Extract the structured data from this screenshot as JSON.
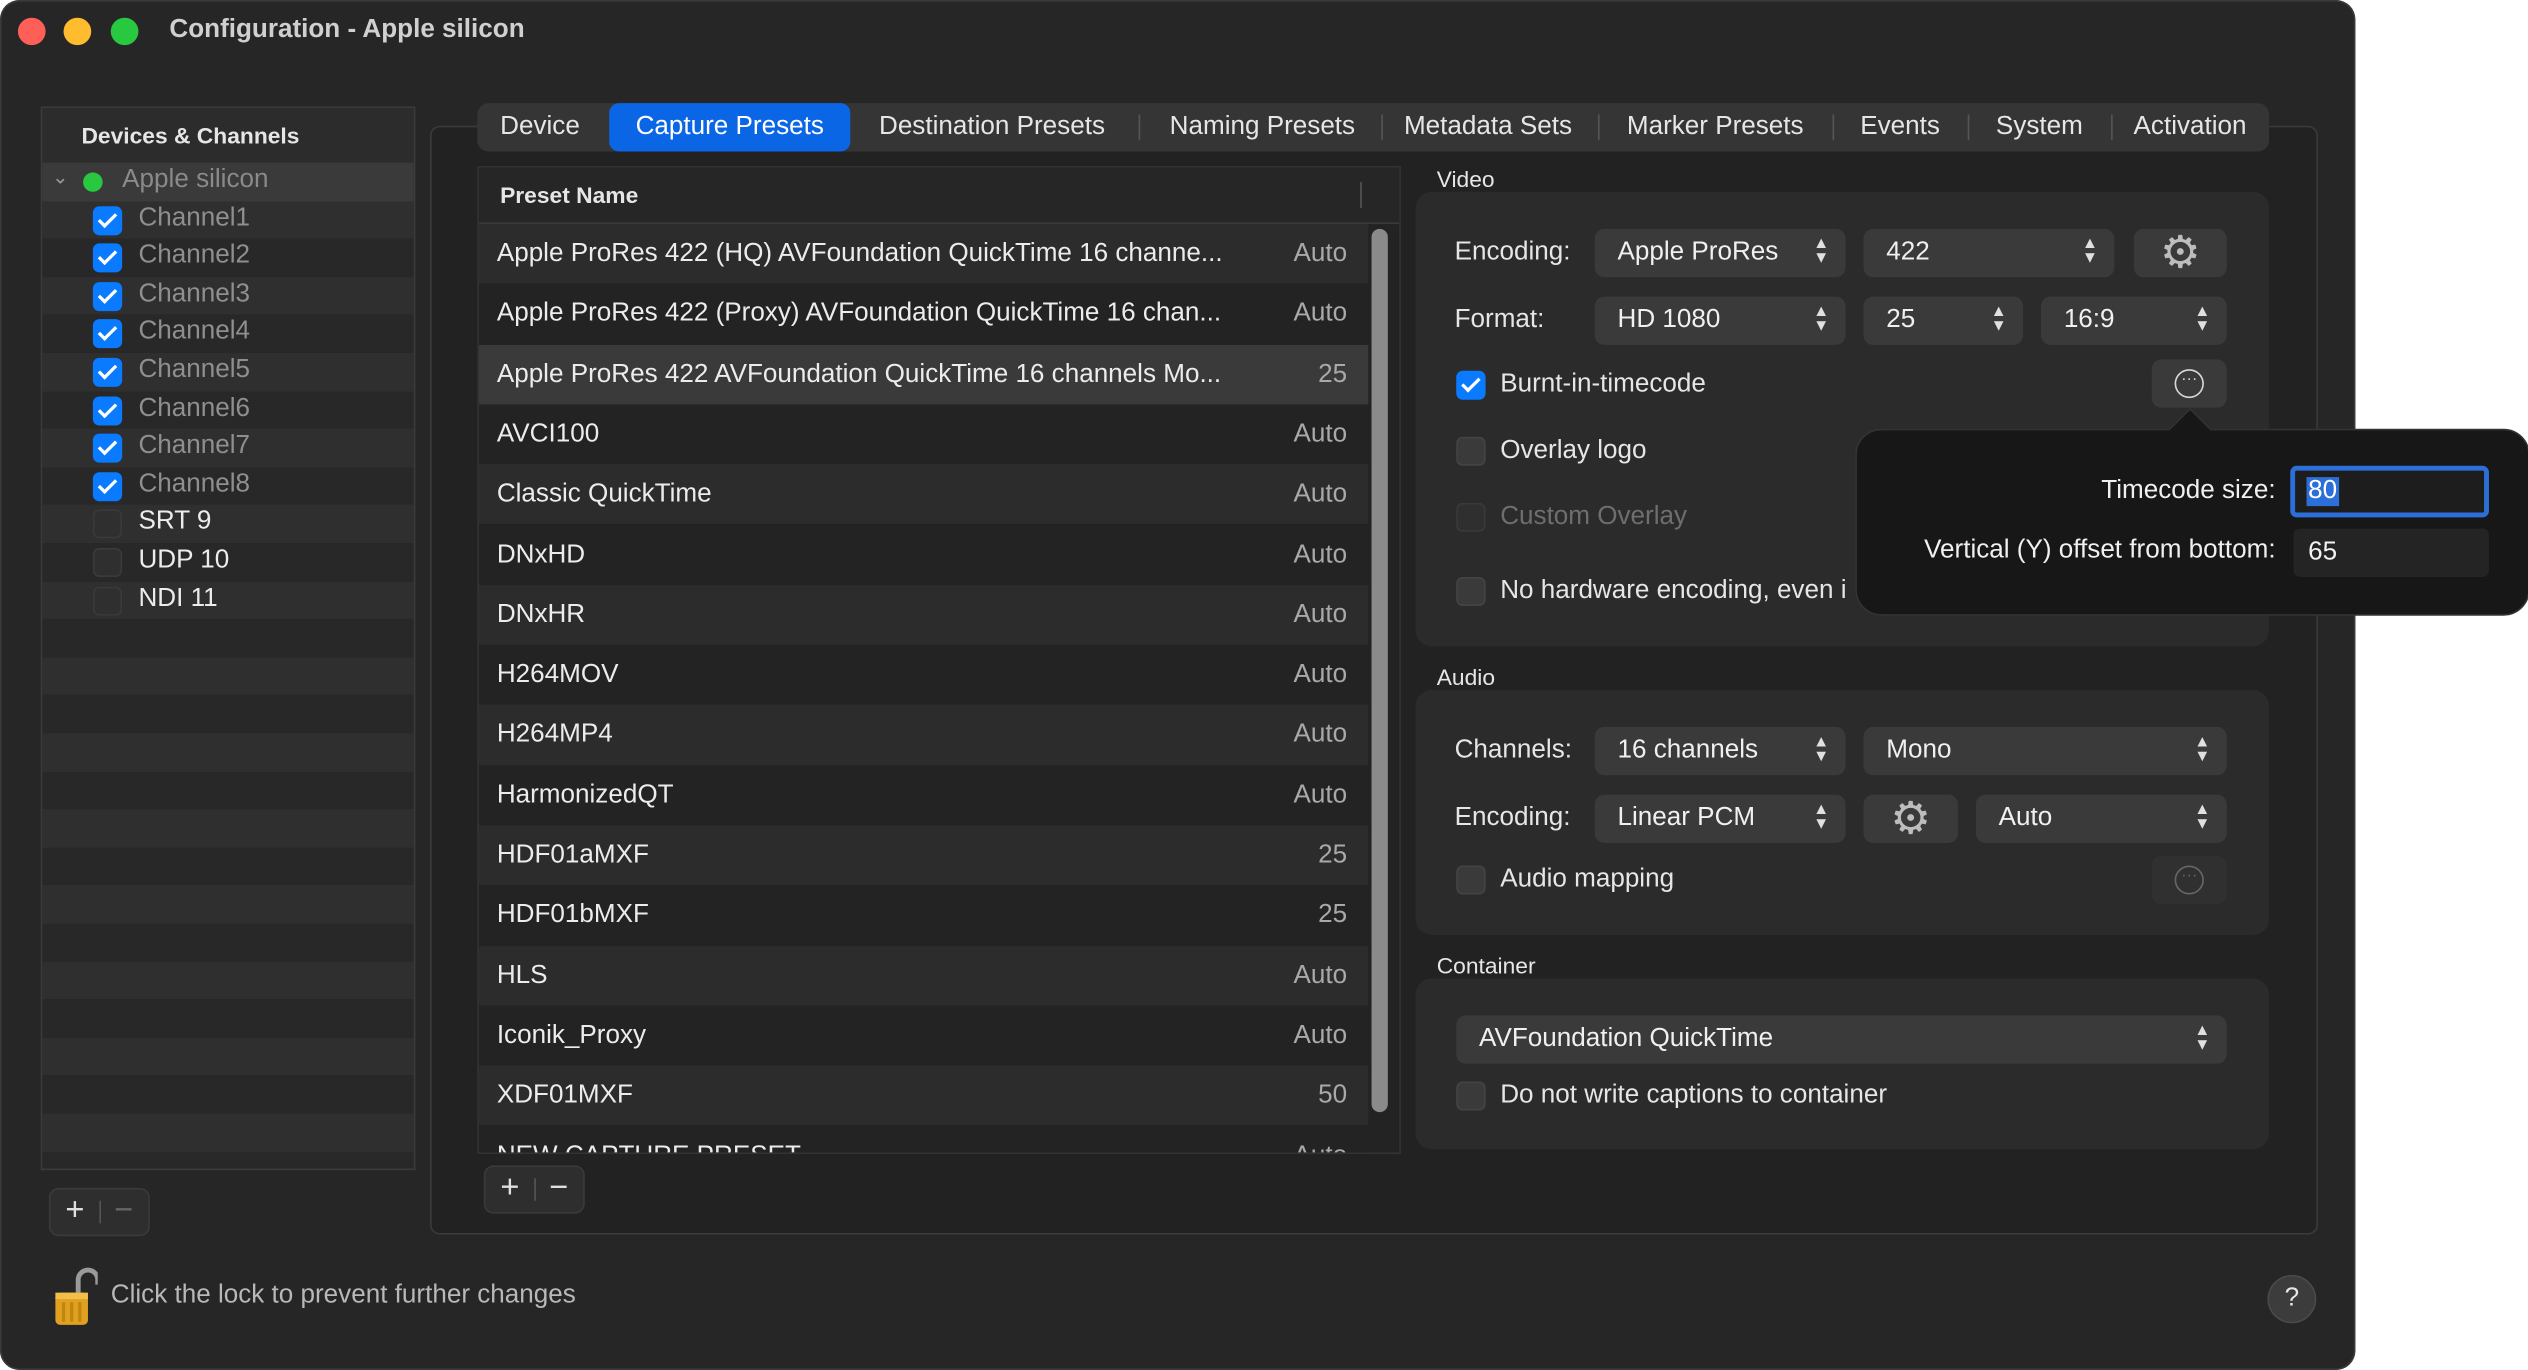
{
  "window": {
    "title": "Configuration - Apple silicon",
    "traffic_colors": [
      "#ff5f57",
      "#febc2e",
      "#28c840"
    ]
  },
  "sidebar": {
    "header": "Devices & Channels",
    "root": {
      "label": "Apple silicon",
      "status_color": "#28c840"
    },
    "items": [
      {
        "label": "Channel1",
        "checked": true
      },
      {
        "label": "Channel2",
        "checked": true
      },
      {
        "label": "Channel3",
        "checked": true
      },
      {
        "label": "Channel4",
        "checked": true
      },
      {
        "label": "Channel5",
        "checked": true
      },
      {
        "label": "Channel6",
        "checked": true
      },
      {
        "label": "Channel7",
        "checked": true
      },
      {
        "label": "Channel8",
        "checked": true
      },
      {
        "label": "SRT 9",
        "checked": false
      },
      {
        "label": "UDP 10",
        "checked": false
      },
      {
        "label": "NDI 11",
        "checked": false
      }
    ],
    "add_label": "+",
    "remove_label": "−"
  },
  "tabs": [
    {
      "label": "Device",
      "active": false
    },
    {
      "label": "Capture Presets",
      "active": true
    },
    {
      "label": "Destination Presets",
      "active": false
    },
    {
      "label": "Naming Presets",
      "active": false
    },
    {
      "label": "Metadata Sets",
      "active": false
    },
    {
      "label": "Marker Presets",
      "active": false
    },
    {
      "label": "Events",
      "active": false
    },
    {
      "label": "System",
      "active": false
    },
    {
      "label": "Activation",
      "active": false
    }
  ],
  "presets": {
    "column_header": "Preset Name",
    "rows": [
      {
        "name": "Apple ProRes 422 (HQ) AVFoundation QuickTime 16 channe...",
        "value": "Auto"
      },
      {
        "name": "Apple ProRes 422 (Proxy) AVFoundation QuickTime 16 chan...",
        "value": "Auto"
      },
      {
        "name": "Apple ProRes 422 AVFoundation QuickTime 16 channels Mo...",
        "value": "25"
      },
      {
        "name": "AVCI100",
        "value": "Auto"
      },
      {
        "name": "Classic QuickTime",
        "value": "Auto"
      },
      {
        "name": "DNxHD",
        "value": "Auto"
      },
      {
        "name": "DNxHR",
        "value": "Auto"
      },
      {
        "name": "H264MOV",
        "value": "Auto"
      },
      {
        "name": "H264MP4",
        "value": "Auto"
      },
      {
        "name": "HarmonizedQT",
        "value": "Auto"
      },
      {
        "name": "HDF01aMXF",
        "value": "25"
      },
      {
        "name": "HDF01bMXF",
        "value": "25"
      },
      {
        "name": "HLS",
        "value": "Auto"
      },
      {
        "name": "Iconik_Proxy",
        "value": "Auto"
      },
      {
        "name": "XDF01MXF",
        "value": "50"
      },
      {
        "name": "NEW CAPTURE PRESET",
        "value": "Auto"
      }
    ],
    "selected_index": 2,
    "add_label": "+",
    "remove_label": "−"
  },
  "video": {
    "section_title": "Video",
    "encoding_label": "Encoding:",
    "encoding_value": "Apple ProRes",
    "encoding_profile": "422",
    "format_label": "Format:",
    "format_value": "HD 1080",
    "frame_rate": "25",
    "aspect": "16:9",
    "burnt_in_label": "Burnt-in-timecode",
    "burnt_in_checked": true,
    "overlay_logo_label": "Overlay logo",
    "custom_overlay_label": "Custom Overlay",
    "no_hw_label": "No hardware encoding, even i"
  },
  "popover": {
    "timecode_size_label": "Timecode size:",
    "timecode_size_value": "80",
    "offset_label": "Vertical (Y) offset from bottom:",
    "offset_value": "65"
  },
  "audio": {
    "section_title": "Audio",
    "channels_label": "Channels:",
    "channels_value": "16 channels",
    "mix_value": "Mono",
    "encoding_label": "Encoding:",
    "encoding_value": "Linear PCM",
    "rate_value": "Auto",
    "mapping_label": "Audio mapping"
  },
  "container": {
    "section_title": "Container",
    "value": "AVFoundation QuickTime",
    "captions_label": "Do not write captions to container"
  },
  "footer": {
    "lock_text": "Click the lock to prevent further changes",
    "help_label": "?"
  }
}
